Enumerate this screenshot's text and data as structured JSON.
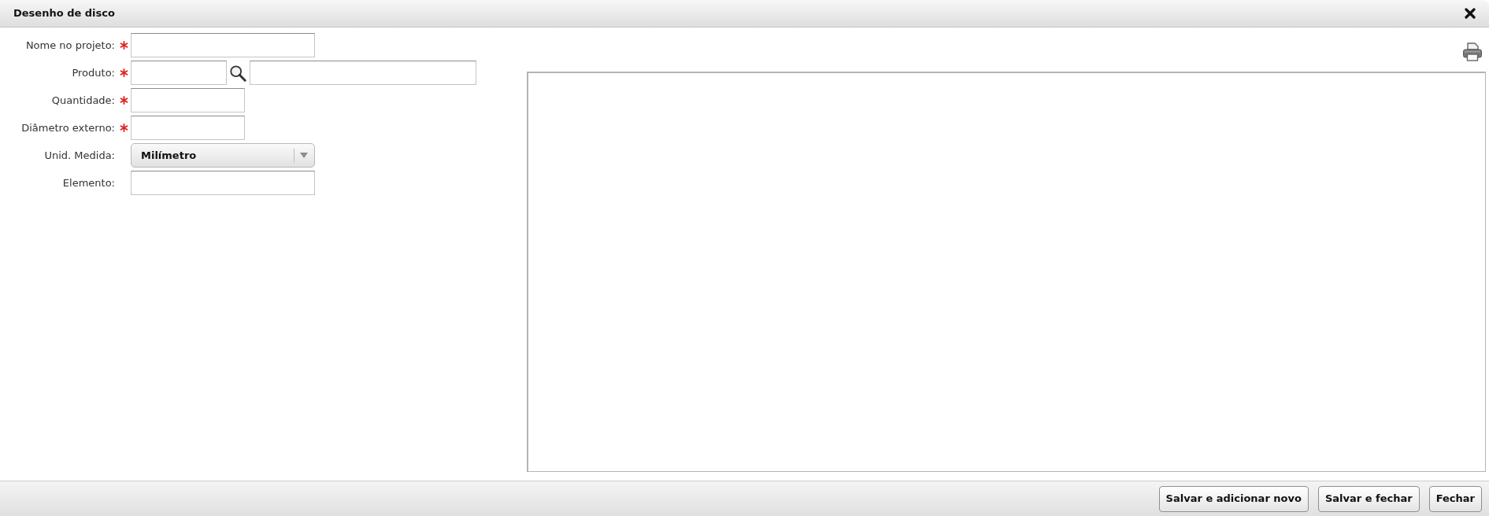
{
  "window": {
    "title": "Desenho de disco"
  },
  "form": {
    "fields": [
      {
        "label": "Nome no projeto:",
        "required": true,
        "kind": "text"
      },
      {
        "label": "Produto:",
        "required": true,
        "kind": "lookup"
      },
      {
        "label": "Quantidade:",
        "required": true,
        "kind": "number"
      },
      {
        "label": "Diâmetro externo:",
        "required": true,
        "kind": "number"
      },
      {
        "label": "Unid. Medida:",
        "required": false,
        "kind": "select",
        "value": "Milímetro"
      },
      {
        "label": "Elemento:",
        "required": false,
        "kind": "text"
      }
    ]
  },
  "buttons": [
    "Salvar e adicionar novo",
    "Salvar e fechar",
    "Fechar"
  ]
}
